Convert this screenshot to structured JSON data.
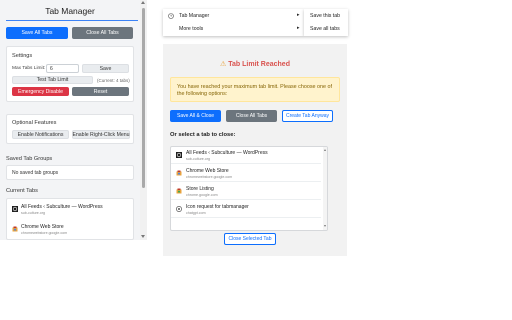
{
  "popup": {
    "title": "Tab Manager",
    "save_all": "Save All Tabs",
    "close_all": "Close All Tabs",
    "settings": {
      "heading": "Settings",
      "max_tabs_label": "Max Tabs Limit:",
      "max_tabs_value": "6",
      "save": "Save",
      "test_tab_limit": "Test Tab Limit",
      "current_tabs": "(Current: 4 tabs)",
      "emergency_disable": "Emergency Disable",
      "reset": "Reset"
    },
    "optional": {
      "heading": "Optional Features",
      "enable_notifications": "Enable Notifications",
      "enable_right_click": "Enable Right-Click Menu"
    },
    "saved_groups": {
      "heading": "Saved Tab Groups",
      "empty": "No saved tab groups"
    },
    "current_tabs": {
      "heading": "Current Tabs",
      "items": [
        {
          "title": "All Feeds ‹ Subculture — WordPress",
          "url": "sub-culture.org",
          "icon": "wordpress-icon"
        },
        {
          "title": "Chrome Web Store",
          "url": "chromewebstore.google.com",
          "icon": "chrome-web-store-icon"
        }
      ]
    }
  },
  "context_menu": {
    "items": [
      {
        "label": "Tab Manager",
        "icon": "clock-icon"
      },
      {
        "label": "More tools",
        "icon": ""
      }
    ],
    "submenu": [
      "Save this tab",
      "Save all tabs"
    ]
  },
  "dialog": {
    "title": "Tab Limit Reached",
    "warning_icon": "⚠",
    "warning": "You have reached your maximum tab limit. Please choose one of the following options:",
    "save_all_close": "Save All & Close",
    "close_all": "Close All Tabs",
    "create_anyway": "Create Tab Anyway",
    "select_prompt": "Or select a tab to close:",
    "tabs": [
      {
        "title": "All Feeds ‹ Subculture — WordPress",
        "url": "sub-culture.org",
        "icon": "wordpress-icon"
      },
      {
        "title": "Chrome Web Store",
        "url": "chromewebstore.google.com",
        "icon": "chrome-web-store-icon"
      },
      {
        "title": "Store Listing",
        "url": "chrome.google.com",
        "icon": "chrome-store-icon"
      },
      {
        "title": "Icon request for tabmanager",
        "url": "chatgpt.com",
        "icon": "chatgpt-icon"
      }
    ],
    "close_selected": "Close Selected Tab"
  },
  "colors": {
    "primary": "#0d6efd",
    "secondary": "#6c757d",
    "danger": "#dc3545",
    "warning_bg": "#fff3cd",
    "warning_text": "#856404",
    "title_red": "#d9534f"
  }
}
